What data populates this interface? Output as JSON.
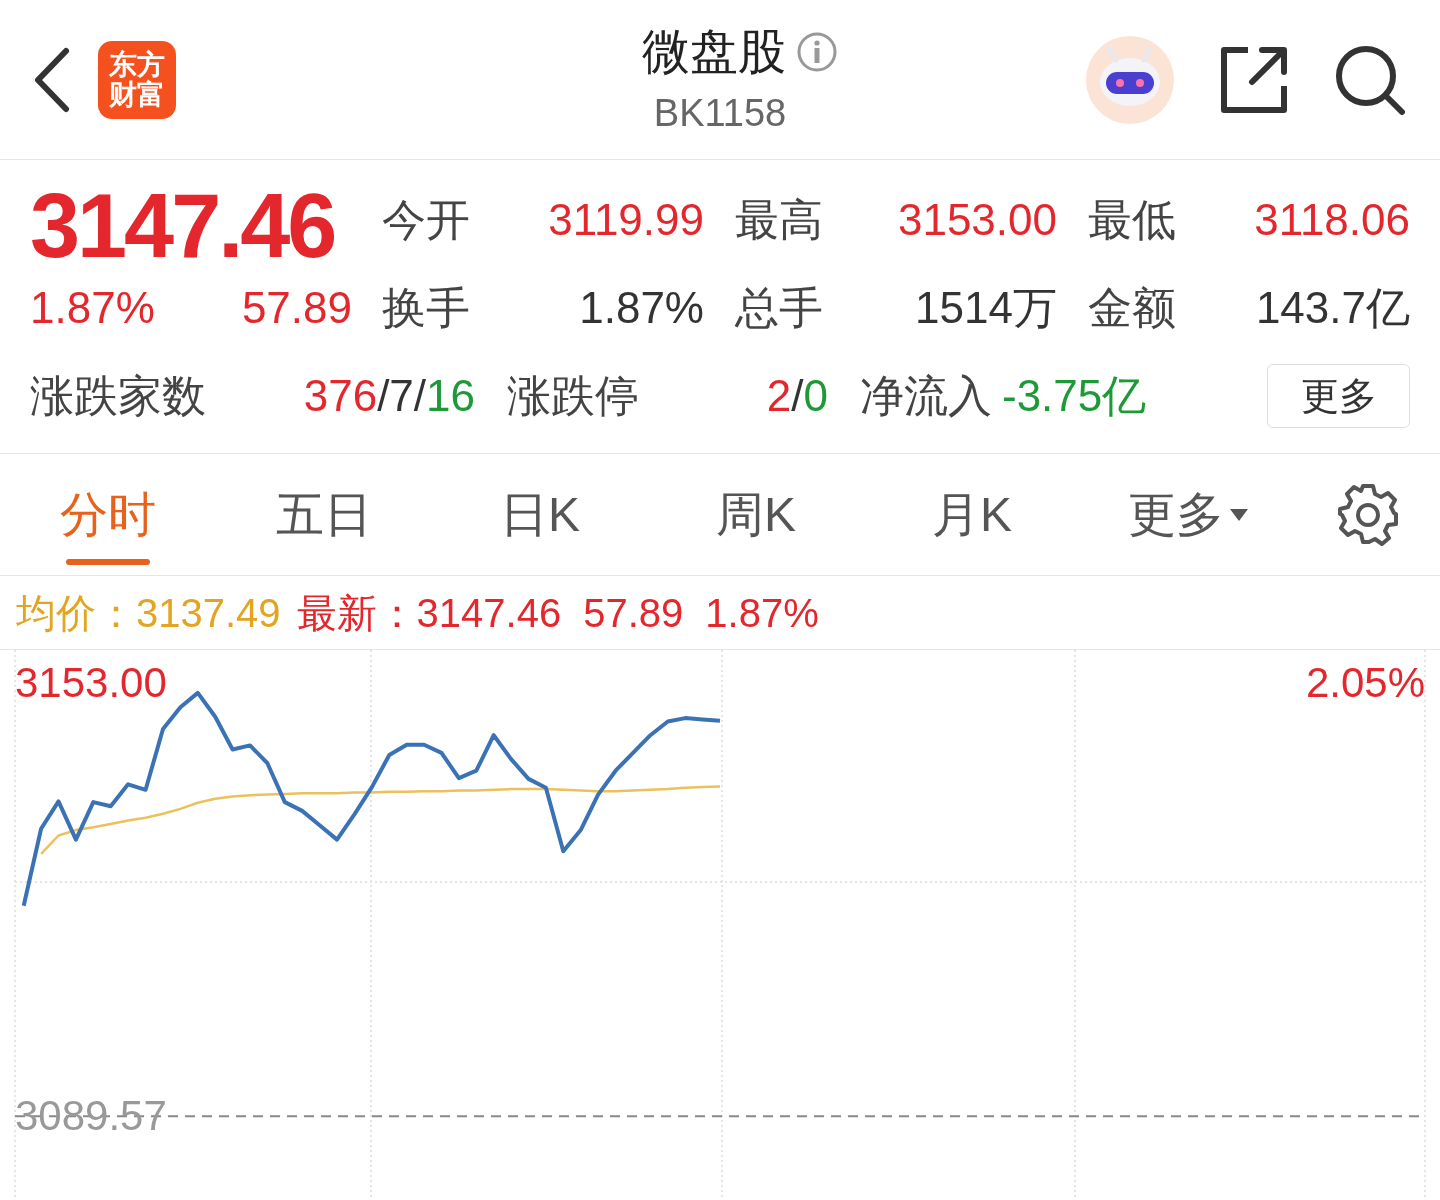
{
  "header": {
    "logo_lines": [
      "东方",
      "财富"
    ],
    "title": "微盘股",
    "code": "BK1158"
  },
  "quote": {
    "price": "3147.46",
    "change_pct": "1.87%",
    "change": "57.89",
    "color": "#e3272d",
    "stats": [
      {
        "label": "今开",
        "value": "3119.99",
        "color": "#e3272d"
      },
      {
        "label": "最高",
        "value": "3153.00",
        "color": "#e3272d"
      },
      {
        "label": "最低",
        "value": "3118.06",
        "color": "#e3272d"
      },
      {
        "label": "换手",
        "value": "1.87%",
        "color": "#333333"
      },
      {
        "label": "总手",
        "value": "1514万",
        "color": "#333333"
      },
      {
        "label": "金额",
        "value": "143.7亿",
        "color": "#333333"
      }
    ],
    "extra": [
      {
        "label": "涨跌家数",
        "parts": [
          {
            "text": "376",
            "color": "#e3272d"
          },
          {
            "text": "/7/",
            "color": "#333333"
          },
          {
            "text": "16",
            "color": "#1d9a37"
          }
        ]
      },
      {
        "label": "涨跌停",
        "parts": [
          {
            "text": "2",
            "color": "#e3272d"
          },
          {
            "text": "/",
            "color": "#333333"
          },
          {
            "text": "0",
            "color": "#1d9a37"
          }
        ]
      },
      {
        "label": "净流入",
        "parts": [
          {
            "text": "-3.75亿",
            "color": "#1d9a37"
          }
        ]
      }
    ],
    "more_button": "更多"
  },
  "tabs": [
    {
      "label": "分时",
      "selected": true,
      "kind": "tab"
    },
    {
      "label": "五日",
      "selected": false,
      "kind": "tab"
    },
    {
      "label": "日K",
      "selected": false,
      "kind": "tab"
    },
    {
      "label": "周K",
      "selected": false,
      "kind": "tab"
    },
    {
      "label": "月K",
      "selected": false,
      "kind": "tab"
    },
    {
      "label": "更多",
      "selected": false,
      "kind": "dropdown"
    }
  ],
  "legend": {
    "avg_value": "3137.49",
    "last_value": "3147.46",
    "change": "57.89",
    "change_pct": "1.87%"
  },
  "chart": {
    "right_label": "2.05%",
    "chart_data": {
      "type": "line",
      "categories": [
        null,
        null,
        null,
        null,
        null,
        null,
        null,
        null,
        null,
        null,
        null,
        null,
        null,
        null,
        null,
        null,
        null,
        null,
        null,
        null,
        null,
        null,
        null,
        null,
        null,
        null,
        null,
        null,
        null,
        null,
        null,
        null,
        null,
        null,
        null,
        null,
        null,
        null,
        null,
        null,
        null,
        null,
        null,
        null,
        null,
        null,
        null,
        null,
        null,
        null,
        null,
        null,
        null,
        null,
        null,
        null,
        null,
        null,
        null,
        null,
        null,
        null,
        null,
        null,
        null,
        null,
        null,
        null,
        null,
        null,
        null,
        null,
        null,
        null,
        null,
        null,
        null,
        null,
        null,
        null,
        null
      ],
      "ylim": [
        3077.3,
        3157.88
      ],
      "ref_lines": [
        {
          "axis": "y",
          "value": 3089.57
        }
      ],
      "yticks": [
        {
          "value": 3153,
          "label": "3153.00"
        },
        {
          "value": 3089.57,
          "label": "3089.57"
        }
      ],
      "series": [
        {
          "name": "最新：",
          "color": "#3a72b5",
          "values": [
            3120.4,
            3131.7,
            3135.7,
            3130.1,
            3135.6,
            3135.0,
            3138.2,
            3137.4,
            3146.3,
            3149.5,
            3151.6,
            3148.1,
            3143.3,
            3143.9,
            3141.3,
            3135.6,
            3134.3,
            3132.2,
            3130.1,
            3133.8,
            3137.8,
            3142.5,
            3144.0,
            3144.0,
            3142.8,
            3139.1,
            3140.2,
            3145.4,
            3141.9,
            3139.0,
            3137.7,
            3128.4,
            3131.5,
            3136.7,
            3140.2,
            3142.8,
            3145.4,
            3147.4,
            3147.9,
            3147.7,
            3147.5,
            null,
            null,
            null,
            null,
            null,
            null,
            null,
            null,
            null,
            null,
            null,
            null,
            null,
            null,
            null,
            null,
            null,
            null,
            null,
            null,
            null,
            null,
            null,
            null,
            null,
            null,
            null,
            null,
            null,
            null,
            null,
            null,
            null,
            null,
            null,
            null,
            null,
            null,
            null,
            null
          ]
        },
        {
          "name": "均价：",
          "color": "#ecc05a",
          "values": [
            null,
            3128.0,
            3130.7,
            3131.5,
            3131.9,
            3132.4,
            3132.9,
            3133.3,
            3133.9,
            3134.6,
            3135.5,
            3136.1,
            3136.4,
            3136.6,
            3136.7,
            3136.8,
            3136.9,
            3136.9,
            3136.9,
            3137.0,
            3137.0,
            3137.1,
            3137.1,
            3137.2,
            3137.2,
            3137.3,
            3137.3,
            3137.4,
            3137.5,
            3137.5,
            3137.5,
            3137.4,
            3137.3,
            3137.2,
            3137.2,
            3137.3,
            3137.4,
            3137.5,
            3137.7,
            3137.8,
            3137.9,
            null,
            null,
            null,
            null,
            null,
            null,
            null,
            null,
            null,
            null,
            null,
            null,
            null,
            null,
            null,
            null,
            null,
            null,
            null,
            null,
            null,
            null,
            null,
            null,
            null,
            null,
            null,
            null,
            null,
            null,
            null,
            null,
            null,
            null,
            null,
            null,
            null,
            null,
            null,
            null
          ]
        }
      ]
    }
  }
}
